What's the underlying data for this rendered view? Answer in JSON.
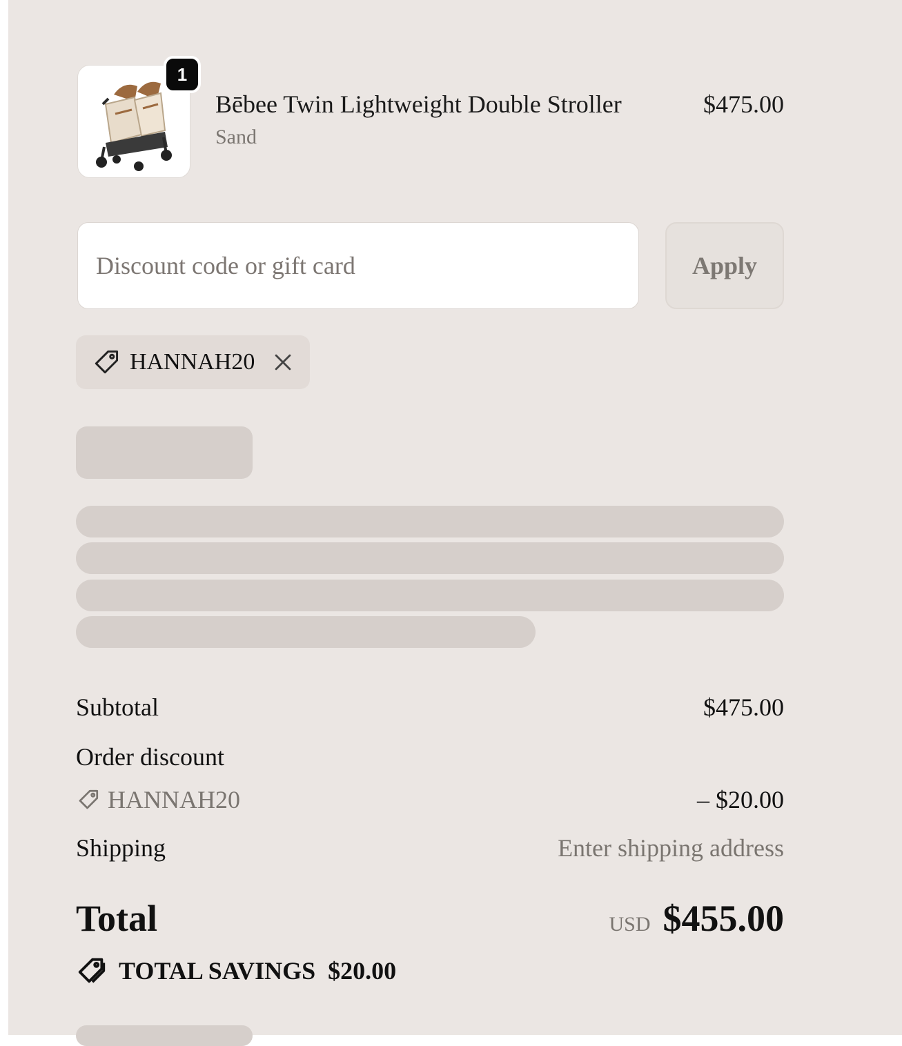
{
  "cart": {
    "quantity_badge": "1",
    "item": {
      "name": "Bēbee Twin Lightweight Double Stroller",
      "variant": "Sand",
      "price": "$475.00",
      "image_icon": "stroller-image"
    }
  },
  "discount": {
    "placeholder": "Discount code or gift card",
    "apply_label": "Apply",
    "applied_code": "HANNAH20"
  },
  "summary": {
    "subtotal_label": "Subtotal",
    "subtotal_value": "$475.00",
    "order_discount_label": "Order discount",
    "order_discount_code": "HANNAH20",
    "order_discount_value": "– $20.00",
    "shipping_label": "Shipping",
    "shipping_value": "Enter shipping address",
    "total_label": "Total",
    "currency": "USD",
    "total_value": "$455.00",
    "savings_label": "TOTAL SAVINGS",
    "savings_value": "$20.00"
  },
  "colors": {
    "panel_background": "#ebe6e3",
    "skeleton": "#d6cfcb",
    "text": "#111111",
    "muted_text": "#7a7570"
  }
}
